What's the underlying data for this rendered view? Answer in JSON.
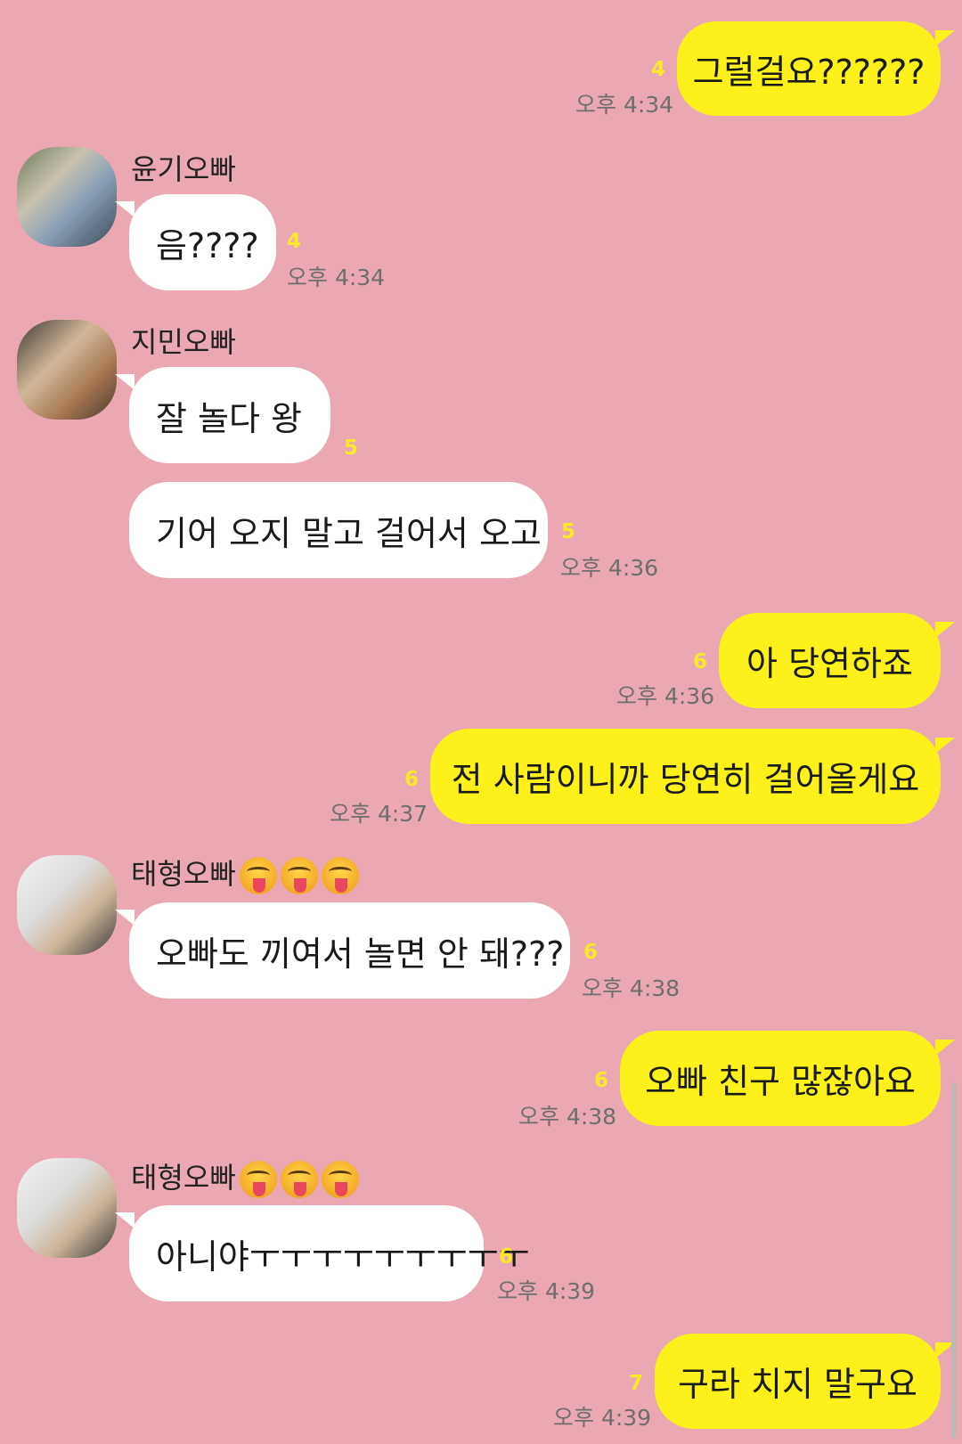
{
  "messages": [
    {
      "text": "그럴걸요??????",
      "unread": "4",
      "time": "오후 4:34"
    },
    {
      "sender": "윤기오빠",
      "text": "음????",
      "unread": "4",
      "time": "오후 4:34"
    },
    {
      "sender": "지민오빠",
      "text": "잘 놀다 왕",
      "unread": "5"
    },
    {
      "text": "기어 오지 말고 걸어서 오고",
      "unread": "5",
      "time": "오후 4:36"
    },
    {
      "text": "아 당연하죠",
      "unread": "6",
      "time": "오후 4:36"
    },
    {
      "text": "전 사람이니까 당연히 걸어올게요",
      "unread": "6",
      "time": "오후 4:37"
    },
    {
      "sender": "태형오빠",
      "text": "오빠도 끼여서 놀면 안 돼???",
      "unread": "6",
      "time": "오후 4:38"
    },
    {
      "text": "오빠 친구 많잖아요",
      "unread": "6",
      "time": "오후 4:38"
    },
    {
      "sender": "태형오빠",
      "text": "아니야ㅜㅜㅜㅜㅜㅜㅜㅜㅜ",
      "unread": "6",
      "time": "오후 4:39"
    },
    {
      "text": "구라 치지 말구요",
      "unread": "7",
      "time": "오후 4:39"
    }
  ],
  "icons": {
    "sender_emoji": "squinting-tongue-face-emoji",
    "avatar": "profile-photo"
  },
  "colors": {
    "background": "#eba8b3",
    "my_bubble": "#fef01b",
    "their_bubble": "#ffffff",
    "unread": "#fbe829",
    "time": "#6e6e6e"
  }
}
